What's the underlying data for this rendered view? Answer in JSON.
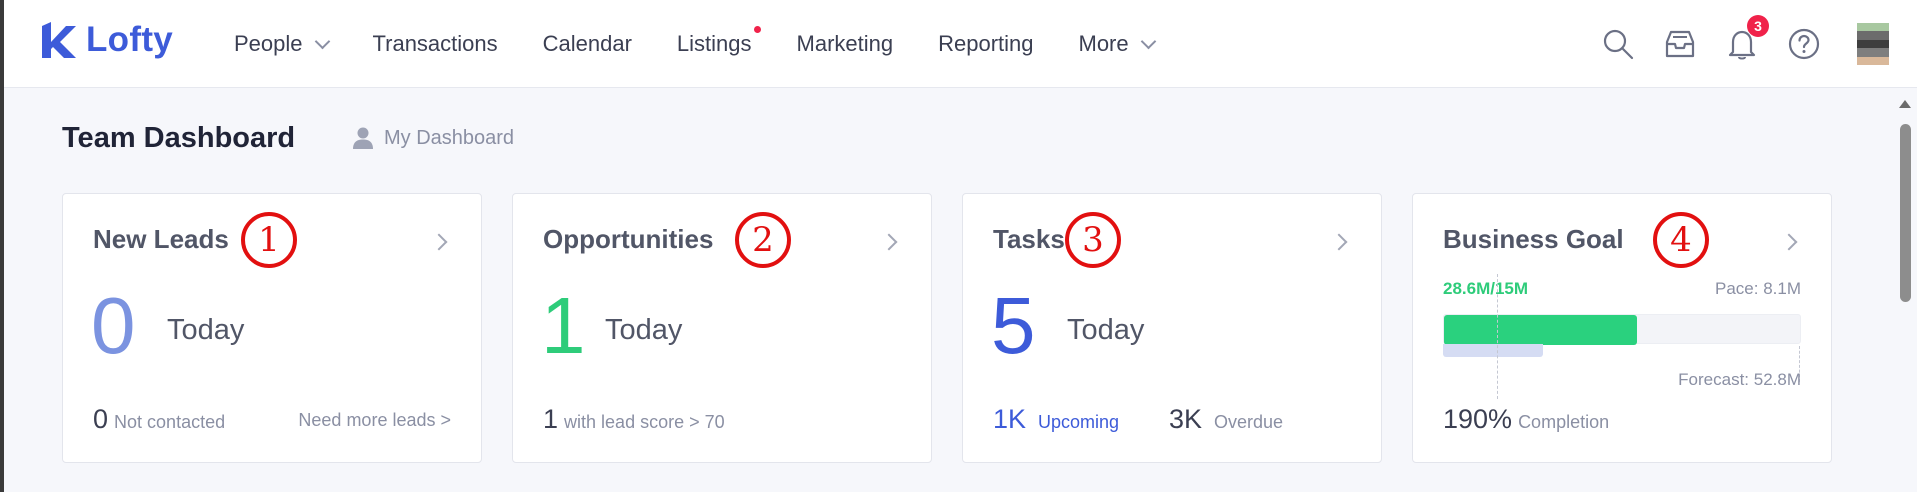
{
  "brand": {
    "name": "Lofty",
    "color": "#3d5bd9"
  },
  "nav": {
    "items": [
      {
        "label": "People",
        "has_dropdown": true
      },
      {
        "label": "Transactions"
      },
      {
        "label": "Calendar"
      },
      {
        "label": "Listings",
        "has_dot": true
      },
      {
        "label": "Marketing"
      },
      {
        "label": "Reporting"
      },
      {
        "label": "More",
        "has_dropdown": true
      }
    ]
  },
  "header_icons": {
    "search": "search-icon",
    "inbox": "inbox-icon",
    "notifications": {
      "icon": "bell-icon",
      "count": "3"
    },
    "help": "help-icon"
  },
  "page": {
    "title": "Team Dashboard",
    "my_dashboard": "My Dashboard"
  },
  "cards": {
    "new_leads": {
      "title": "New Leads",
      "marker": "1",
      "value": "0",
      "value_color": "#7b93e0",
      "period": "Today",
      "foot_num": "0",
      "foot_label": "Not contacted",
      "link": "Need more leads >"
    },
    "opportunities": {
      "title": "Opportunities",
      "marker": "2",
      "value": "1",
      "value_color": "#2ecc7a",
      "period": "Today",
      "foot_num": "1",
      "foot_label": "with lead score > 70"
    },
    "tasks": {
      "title": "Tasks",
      "marker": "3",
      "value": "5",
      "value_color": "#3d5bd9",
      "period": "Today",
      "upcoming_num": "1K",
      "upcoming_label": "Upcoming",
      "overdue_num": "3K",
      "overdue_label": "Overdue"
    },
    "business_goal": {
      "title": "Business Goal",
      "marker": "4",
      "progress": "28.6M/15M",
      "pace": "Pace: 8.1M",
      "forecast": "Forecast: 52.8M",
      "completion_value": "190%",
      "completion_label": "Completion",
      "fill_fraction": 0.54,
      "forecast_bar_fraction": 0.28,
      "pace_marker_fraction": 0.15
    }
  }
}
